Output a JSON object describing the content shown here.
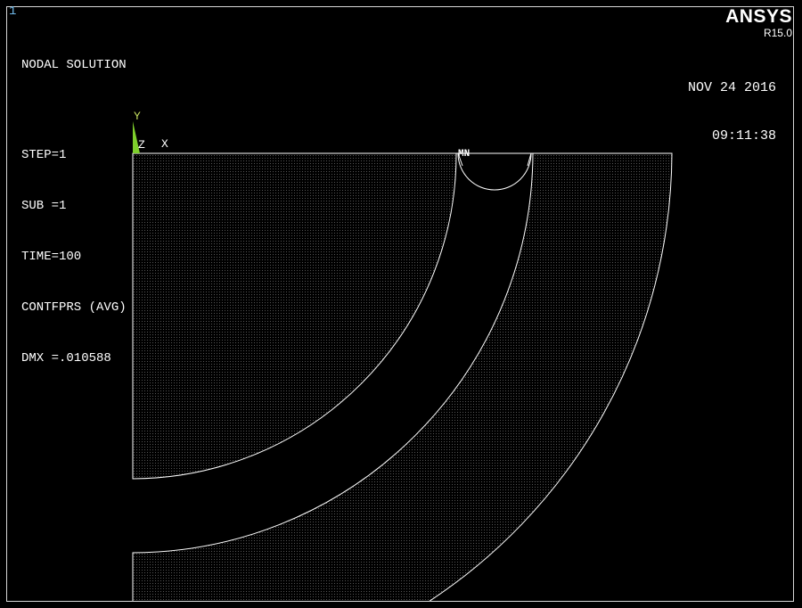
{
  "window": {
    "number": "1"
  },
  "info": {
    "title": "NODAL SOLUTION",
    "step": "STEP=1",
    "sub": "SUB =1",
    "time": "TIME=100",
    "contour": "CONTFPRS (AVG)",
    "dmx": "DMX =.010588"
  },
  "brand": {
    "name": "ANSYS",
    "version": "R15.0"
  },
  "timestamp": {
    "date": "NOV 24 2016",
    "time": "09:11:38"
  },
  "triad": {
    "y_label": "Y",
    "z_label": "Z",
    "x_label": "X"
  },
  "markers": {
    "min_label": "MN"
  },
  "colors": {
    "background": "#000000",
    "text": "#ffffff",
    "frame": "#d8d8d8",
    "mesh_edge": "#ffffff",
    "mesh_fill": "#1a1a1a",
    "window_number": "#6fb8e8",
    "triad_y": "#c6e060",
    "triad_arrow": "#7ecf2c"
  }
}
